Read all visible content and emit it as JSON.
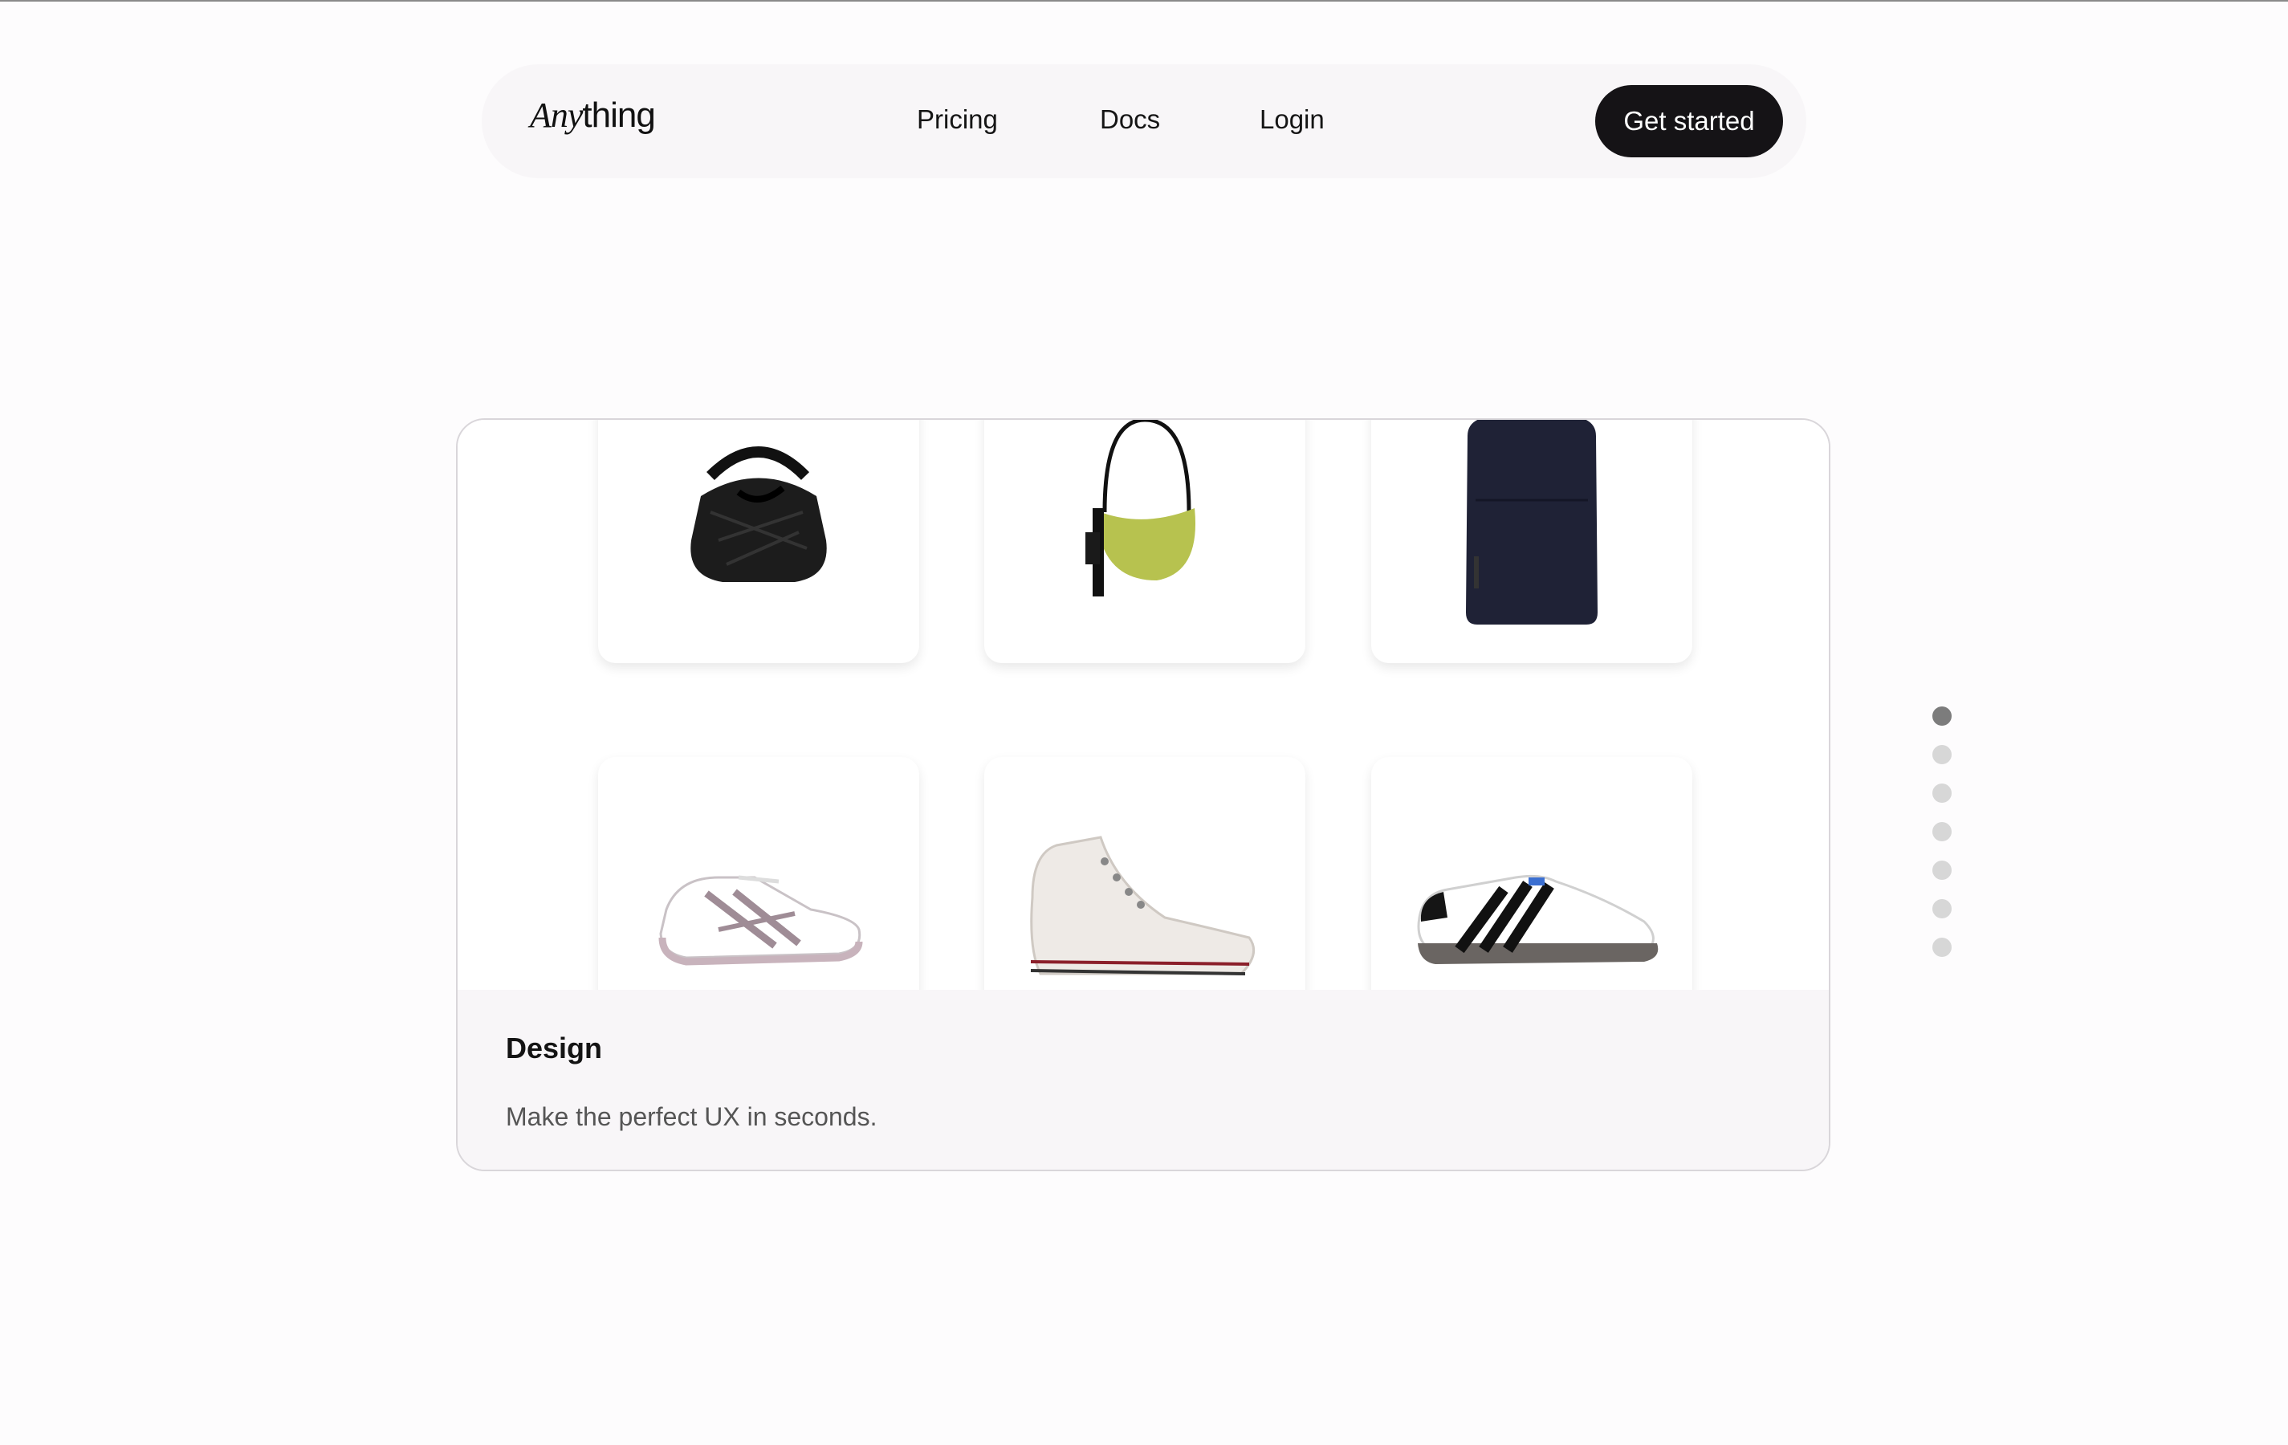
{
  "nav": {
    "logo_italic": "Any",
    "logo_regular": "thing",
    "links": [
      "Pricing",
      "Docs",
      "Login"
    ],
    "cta_label": "Get started"
  },
  "feature": {
    "title": "Design",
    "subtitle": "Make the perfect UX in seconds.",
    "products": [
      {
        "name": "black-woven-handbag-icon",
        "color": "#1a1a1a"
      },
      {
        "name": "lime-shoulder-bag-icon",
        "color": "#b9c24e"
      },
      {
        "name": "navy-backpack-icon",
        "color": "#1f2236"
      },
      {
        "name": "white-running-shoe-icon",
        "color": "#b9a4ad"
      },
      {
        "name": "cream-high-top-sneaker-icon",
        "color": "#eeeae6"
      },
      {
        "name": "white-three-stripe-sneaker-icon",
        "color": "#1b1b1b"
      }
    ]
  },
  "pager": {
    "count": 7,
    "active_index": 0
  }
}
